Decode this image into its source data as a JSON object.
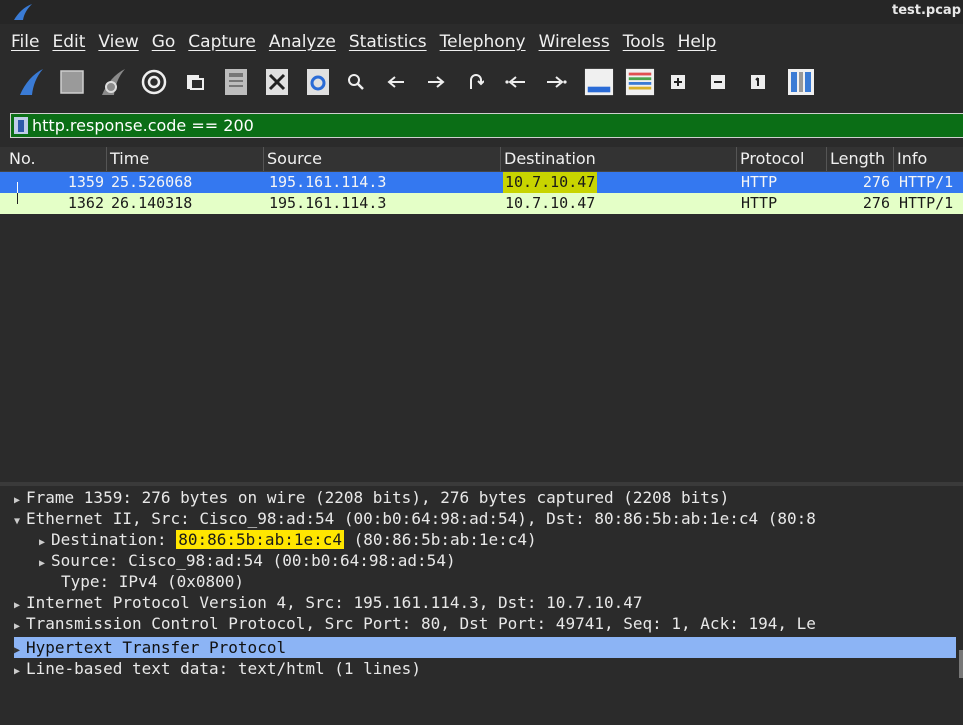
{
  "window": {
    "title": "test.pcap"
  },
  "menu": [
    "File",
    "Edit",
    "View",
    "Go",
    "Capture",
    "Analyze",
    "Statistics",
    "Telephony",
    "Wireless",
    "Tools",
    "Help"
  ],
  "toolbar": {
    "icons": [
      "shark-fin-start-icon",
      "stop-capture-icon",
      "restart-capture-icon",
      "capture-options-icon",
      "open-file-icon",
      "save-file-icon",
      "close-file-icon",
      "reload-file-icon",
      "find-icon",
      "go-back-icon",
      "go-forward-icon",
      "go-to-packet-icon",
      "first-packet-icon",
      "last-packet-icon",
      "autoscroll-icon",
      "colorize-icon",
      "zoom-in-icon",
      "zoom-out-icon",
      "normal-size-icon",
      "resize-columns-icon"
    ]
  },
  "filter": {
    "value": "http.response.code == 200"
  },
  "packet_list": {
    "columns": [
      "No.",
      "Time",
      "Source",
      "Destination",
      "Protocol",
      "Length",
      "Info"
    ],
    "rows": [
      {
        "no": "1359",
        "time": "25.526068",
        "source": "195.161.114.3",
        "destination": "10.7.10.47",
        "protocol": "HTTP",
        "length": "276",
        "info": "HTTP/1"
      },
      {
        "no": "1362",
        "time": "26.140318",
        "source": "195.161.114.3",
        "destination": "10.7.10.47",
        "protocol": "HTTP",
        "length": "276",
        "info": "HTTP/1"
      }
    ]
  },
  "details": {
    "frame": "Frame 1359: 276 bytes on wire (2208 bits), 276 bytes captured (2208 bits)",
    "ethernet": "Ethernet II, Src: Cisco_98:ad:54 (00:b0:64:98:ad:54), Dst: 80:86:5b:ab:1e:c4 (80:8",
    "eth_dst_label": "Destination: ",
    "eth_dst_value": "80:86:5b:ab:1e:c4",
    "eth_dst_rest": " (80:86:5b:ab:1e:c4)",
    "eth_src": "Source: Cisco_98:ad:54 (00:b0:64:98:ad:54)",
    "eth_type": "Type: IPv4 (0x0800)",
    "ip": "Internet Protocol Version 4, Src: 195.161.114.3, Dst: 10.7.10.47",
    "tcp": "Transmission Control Protocol, Src Port: 80, Dst Port: 49741, Seq: 1, Ack: 194, Le",
    "http": "Hypertext Transfer Protocol",
    "text": "Line-based text data: text/html (1 lines)"
  }
}
